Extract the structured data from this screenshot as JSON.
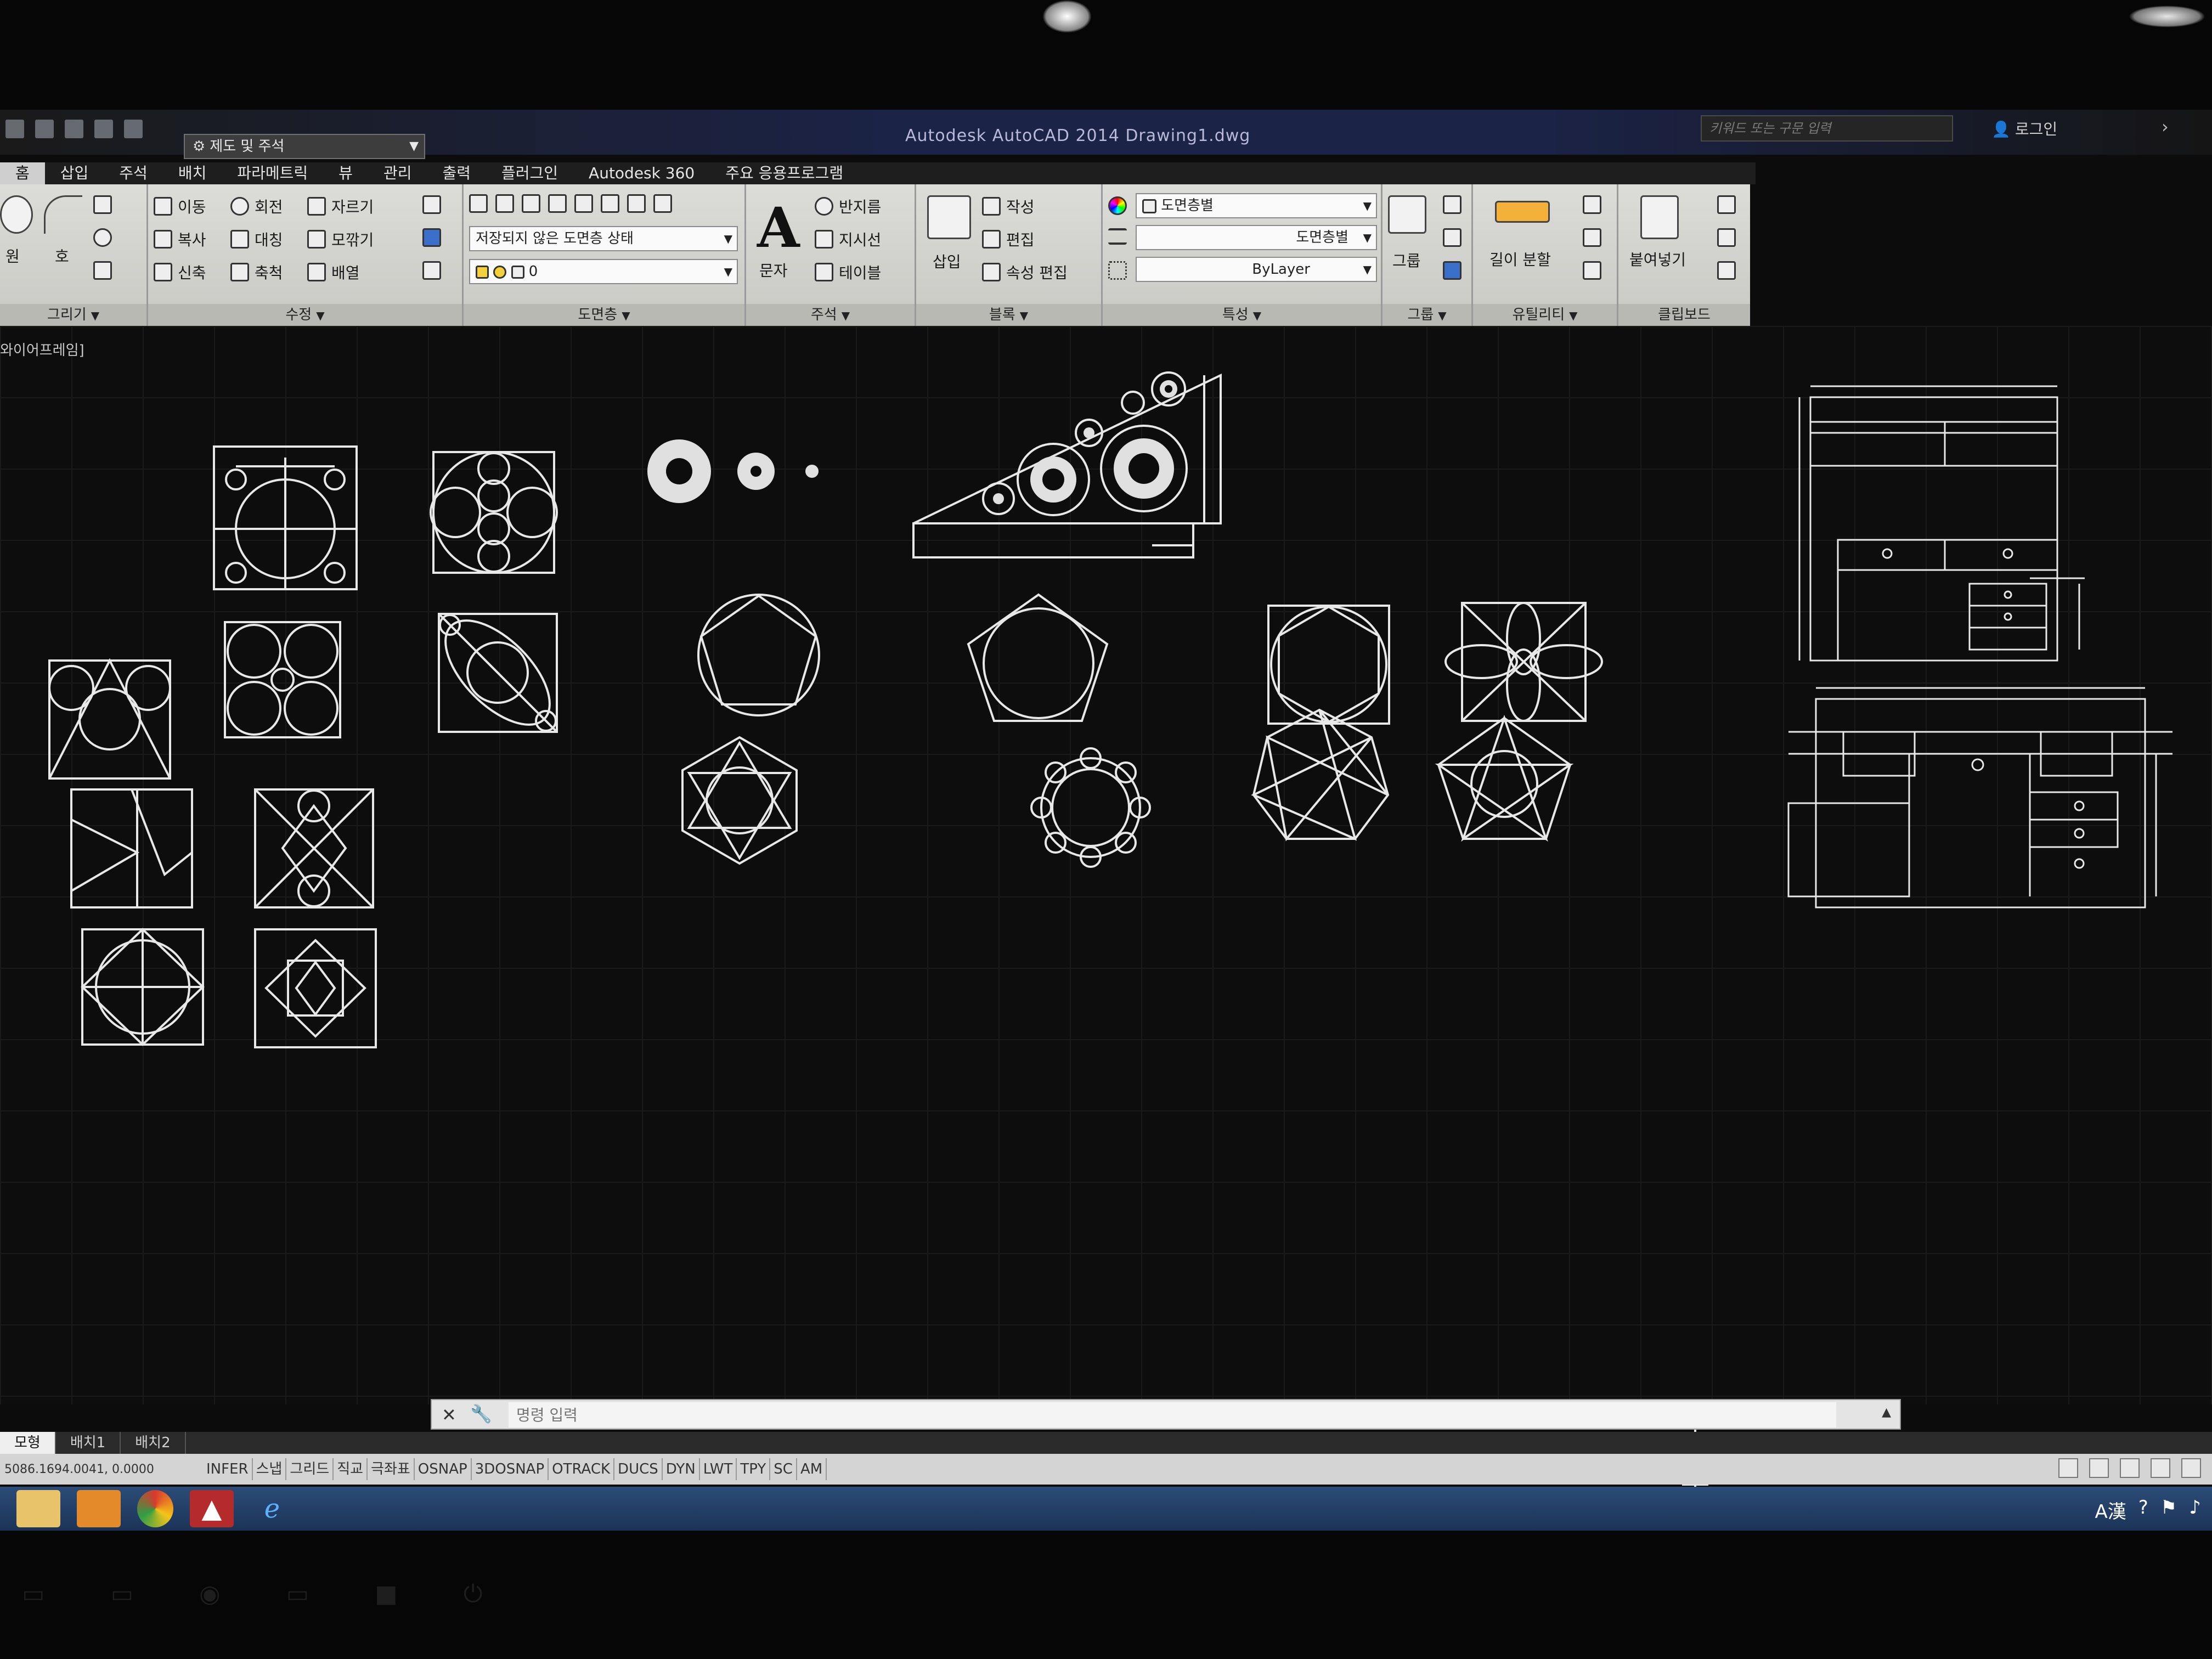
{
  "window": {
    "app_title": "Autodesk AutoCAD 2014    Drawing1.dwg",
    "workspace": "제도 및 주석",
    "search_placeholder": "키워드 또는 구문 입력",
    "login": "로그인"
  },
  "ribbon_tabs": [
    "홈",
    "삽입",
    "주석",
    "배치",
    "파라메트릭",
    "뷰",
    "관리",
    "출력",
    "플러그인",
    "Autodesk 360",
    "주요 응용프로그램"
  ],
  "ribbon": {
    "draw_panel_title": "그리기",
    "draw_line": "원",
    "draw_arc": "호",
    "modify_panel_title": "수정",
    "modify": {
      "move": "이동",
      "rotate": "회전",
      "trim": "자르기",
      "copy": "복사",
      "mirror": "대칭",
      "fillet": "모깎기",
      "stretch": "신축",
      "scale": "축척",
      "array": "배열"
    },
    "layer_panel_title": "도면층",
    "layer_state": "저장되지 않은 도면층 상태",
    "layer_current": "0",
    "annotation_panel_title": "주석",
    "text_label": "문자",
    "dimension": "반지름",
    "leader": "지시선",
    "table": "테이블",
    "block_panel_title": "블록",
    "insert": "삽입",
    "block_create": "작성",
    "block_edit": "편집",
    "attr_edit": "속성 편집",
    "properties_panel_title": "특성",
    "prop_color": "도면층별",
    "prop_linetype": "도면층별",
    "prop_lineweight": "ByLayer",
    "group_panel_title": "그룹",
    "group": "그룹",
    "utilities_panel_title": "유틸리티",
    "measure": "길이 분할",
    "clipboard_panel_title": "클립보드",
    "paste": "붙여넣기"
  },
  "viewport_label": "와이어프레임]",
  "command_line": {
    "placeholder": "명령 입력"
  },
  "layout_tabs": [
    "모형",
    "배치1",
    "배치2"
  ],
  "status": {
    "coords": "5086.1694.0041, 0.0000",
    "toggles": [
      "INFER",
      "스냅",
      "그리드",
      "직교",
      "극좌표",
      "OSNAP",
      "3DOSNAP",
      "OTRACK",
      "DUCS",
      "DYN",
      "LWT",
      "TPY",
      "SC",
      "AM"
    ]
  },
  "colors": {
    "canvas_bg": "#0d0d0d",
    "linework": "#e6e6e6",
    "ribbon_bg": "#d4d4d0",
    "taskbar": "#2b4c78"
  }
}
